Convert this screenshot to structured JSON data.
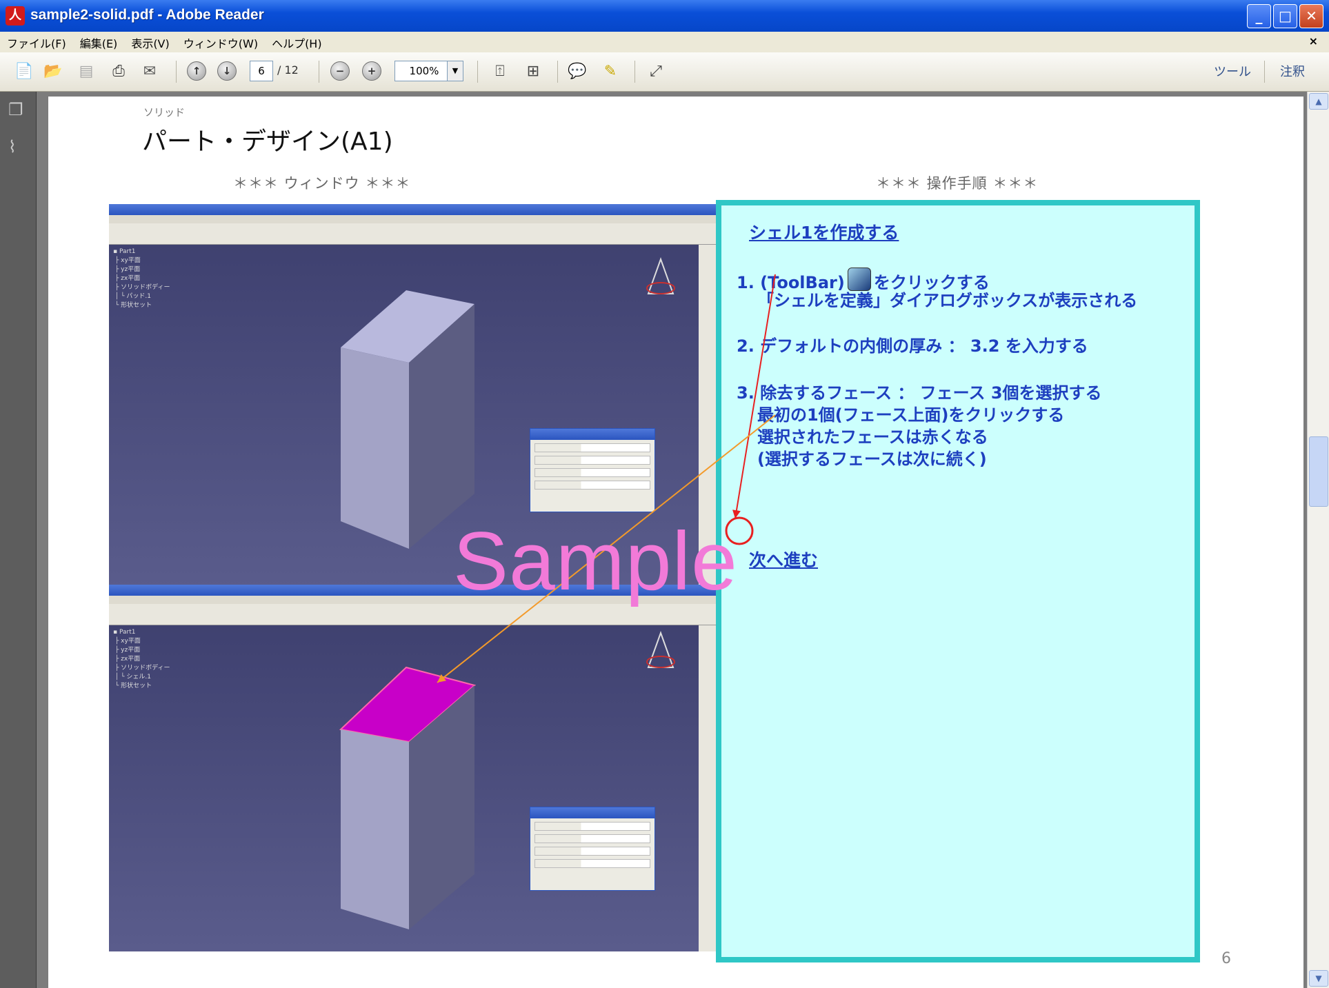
{
  "window": {
    "title": "sample2-solid.pdf - Adobe Reader",
    "minimize": "_",
    "maximize": "□",
    "close": "✕"
  },
  "menu": {
    "items": [
      "ファイル(F)",
      "編集(E)",
      "表示(V)",
      "ウィンドウ(W)",
      "ヘルプ(H)"
    ],
    "close": "×"
  },
  "toolbar": {
    "page_current": "6",
    "page_total": "/ 12",
    "zoom": "100%",
    "tools_label": "ツール",
    "comments_label": "注釈"
  },
  "doc": {
    "subtitle": "ソリッド",
    "title": "パート・デザイン(A1)",
    "window_heading": "＊＊＊ ウィンドウ ＊＊＊",
    "steps_heading": "＊＊＊ 操作手順 ＊＊＊",
    "panel": {
      "heading": "シェル1を作成する",
      "step1a": "1. (ToolBar)",
      "step1b": "をクリックする",
      "step1c": "「シェルを定義」ダイアログボックスが表示される",
      "step2": "2. デフォルトの内側の厚み ： 3.2 を入力する",
      "step3a": "3. 除去するフェース ： フェース 3個を選択する",
      "step3b": "最初の1個(フェース上面)をクリックする",
      "step3c": "選択されたフェースは赤くなる",
      "step3d": "(選択するフェースは次に続く)",
      "next": "次へ進む"
    },
    "watermark": "Sample",
    "page_number": "6"
  },
  "colors": {
    "accent": "#1d3fbf",
    "panel_bg": "#ccfffd",
    "panel_border": "#2fc7c6",
    "watermark": "#f27ad8",
    "face_selected": "#c800c8"
  }
}
